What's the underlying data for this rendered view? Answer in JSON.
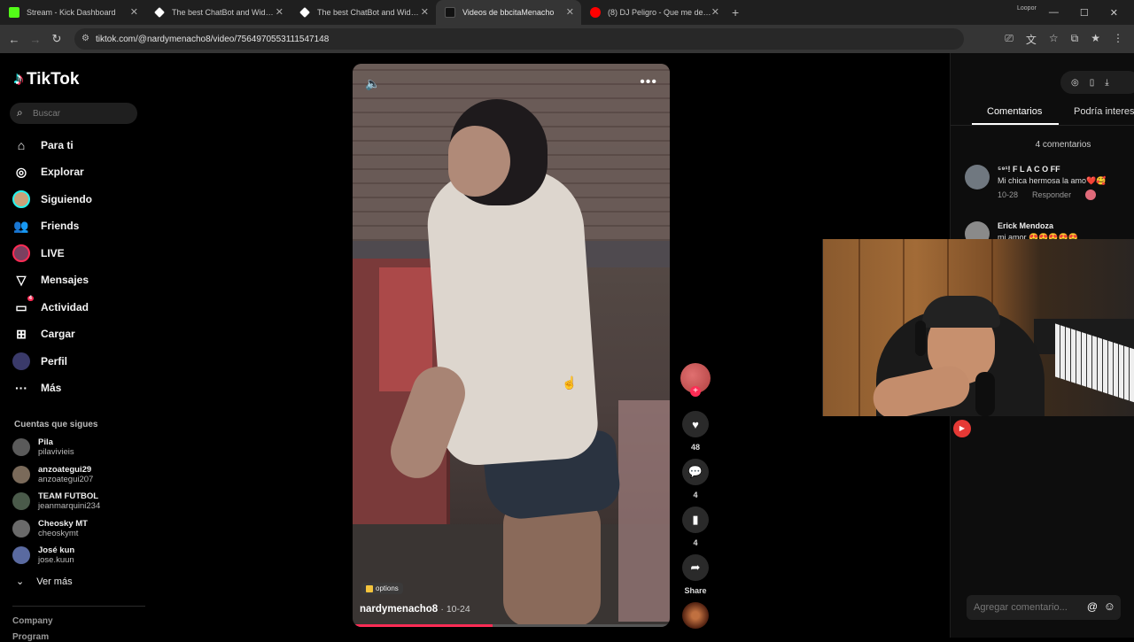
{
  "browser": {
    "tabs": [
      {
        "title": "Stream - Kick Dashboard",
        "color": "#53fc18",
        "active": false
      },
      {
        "title": "The best ChatBot and Widgets",
        "color": "#ffffff",
        "active": false
      },
      {
        "title": "The best ChatBot and Widgets",
        "color": "#ffffff",
        "active": false
      },
      {
        "title": "Videos de bbcitaMenacho",
        "color": "#111111",
        "active": true
      },
      {
        "title": "(8) DJ Peligro - Que me deje co",
        "color": "#ff0000",
        "active": false
      }
    ],
    "profile_label": "Loopor",
    "url": "tiktok.com/@nardymenacho8/video/7564970553111547148"
  },
  "sidebar": {
    "brand": "TikTok",
    "search_placeholder": "Buscar",
    "nav": [
      {
        "label": "Para ti",
        "icon": "home-icon"
      },
      {
        "label": "Explorar",
        "icon": "compass-icon"
      },
      {
        "label": "Siguiendo",
        "icon": "avatar-icon"
      },
      {
        "label": "Friends",
        "icon": "friends-icon"
      },
      {
        "label": "LIVE",
        "icon": "live-icon"
      },
      {
        "label": "Mensajes",
        "icon": "send-icon"
      },
      {
        "label": "Actividad",
        "icon": "inbox-icon",
        "badge": "4"
      },
      {
        "label": "Cargar",
        "icon": "upload-icon"
      },
      {
        "label": "Perfil",
        "icon": "profile-icon"
      },
      {
        "label": "Más",
        "icon": "more-icon"
      }
    ],
    "following_title": "Cuentas que sigues",
    "following": [
      {
        "name": "Pila",
        "handle": "pilavivieis"
      },
      {
        "name": "anzoategui29",
        "handle": "anzoategui207"
      },
      {
        "name": "TEAM FUTBOL",
        "handle": "jeanmarquini234"
      },
      {
        "name": "Cheosky MT",
        "handle": "cheoskymt"
      },
      {
        "name": "José kun",
        "handle": "jose.kuun"
      }
    ],
    "see_more": "Ver más",
    "company": "Company",
    "program": "Program"
  },
  "video": {
    "author": "nardymenacho8",
    "date": "· 10-24",
    "options_label": "options",
    "progress": 0.44
  },
  "actions": {
    "likes": "48",
    "comments": "4",
    "saves": "4",
    "share": "Share"
  },
  "comments_panel": {
    "tab_comments": "Comentarios",
    "tab_suggest": "Podría interes",
    "count": "4 comentarios",
    "items": [
      {
        "user": "⁵⁹¹! F L A C O FF",
        "text": "Mi chica hermosa la amo❤️🥰",
        "date": "10-28",
        "reply": "Responder"
      },
      {
        "user": "Erick Mendoza",
        "text": "mi amor 😍😍😍😍😍",
        "date": "",
        "reply": ""
      }
    ],
    "input_placeholder": "Agregar comentario..."
  }
}
